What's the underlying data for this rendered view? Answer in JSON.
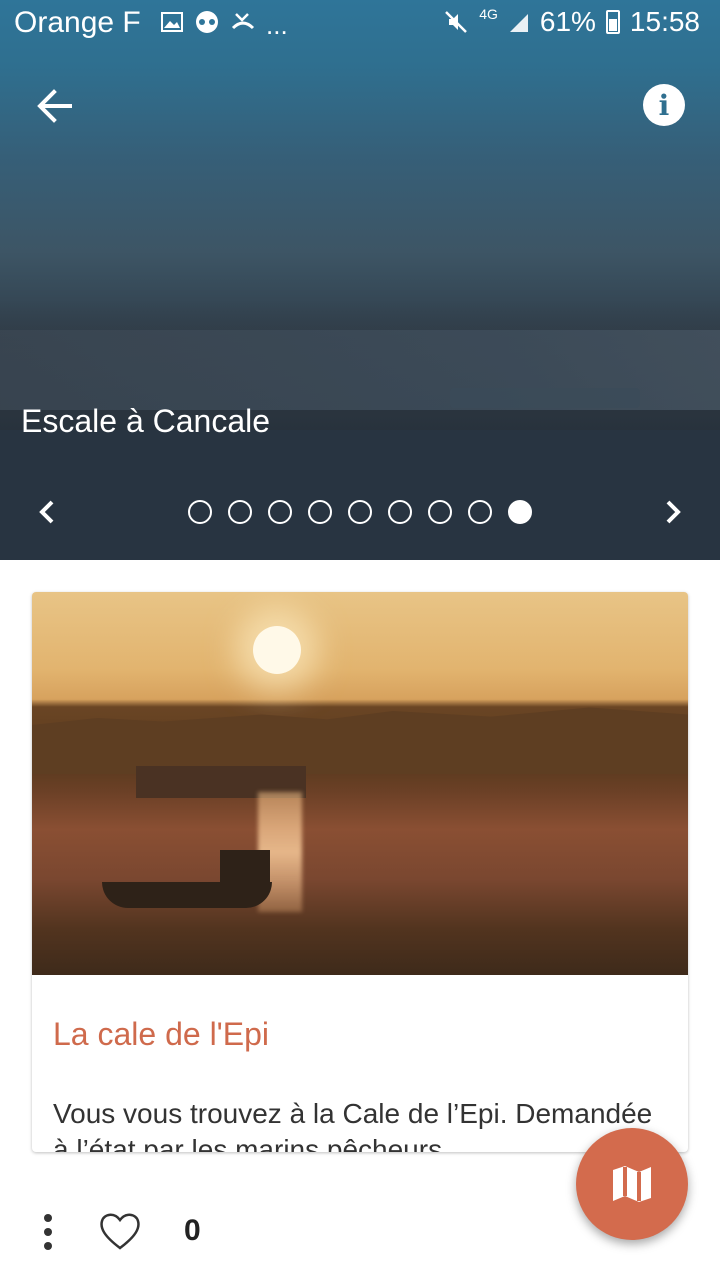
{
  "status_bar": {
    "carrier": "Orange F",
    "overflow": "...",
    "network": "4G",
    "battery": "61%",
    "time": "15:58",
    "icons": [
      "image-icon",
      "voicemail-icon",
      "missed-call-icon",
      "mute-icon",
      "signal-icon",
      "battery-icon"
    ]
  },
  "app_bar": {
    "back_icon": "arrow-back-icon",
    "info_icon": "info-icon"
  },
  "hero": {
    "title": "Escale à Cancale",
    "pager": {
      "total": 9,
      "current": 9,
      "prev_icon": "chevron-left-icon",
      "next_icon": "chevron-right-icon"
    }
  },
  "card": {
    "title": "La cale de l'Epi",
    "text": "Vous vous trouvez à la Cale de l’Epi. Demandée à l’état par les marins pêcheurs",
    "title_color": "#cf6a4c"
  },
  "actions": {
    "more_icon": "more-vertical-icon",
    "like_icon": "heart-outline-icon",
    "like_count": "0",
    "map_icon": "map-icon",
    "fab_color": "#d36b4d"
  }
}
